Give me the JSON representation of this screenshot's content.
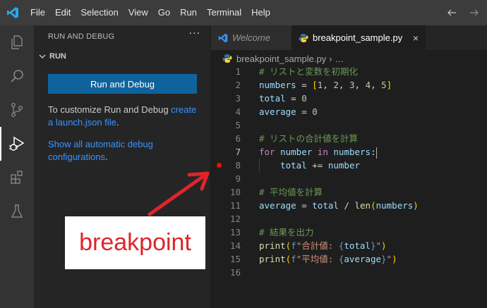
{
  "menu": [
    "File",
    "Edit",
    "Selection",
    "View",
    "Go",
    "Run",
    "Terminal",
    "Help"
  ],
  "sidebar": {
    "title": "RUN AND DEBUG",
    "more": "···",
    "section": "RUN",
    "run_button": "Run and Debug",
    "customize_text": "To customize Run and Debug ",
    "customize_link": "create a launch.json file",
    "customize_end": ".",
    "show_link": "Show all automatic debug configurations",
    "show_end": "."
  },
  "tabs": [
    {
      "label": "Welcome"
    },
    {
      "label": "breakpoint_sample.py",
      "close": "×"
    }
  ],
  "breadcrumb": {
    "file": "breakpoint_sample.py",
    "sep": "›",
    "rest": "…"
  },
  "breakpoint_line": 8,
  "current_line": 7,
  "code_lines": [
    {
      "n": "1",
      "text": "# リストと変数を初期化"
    },
    {
      "n": "2",
      "text": "numbers = [1, 2, 3, 4, 5]"
    },
    {
      "n": "3",
      "text": "total = 0"
    },
    {
      "n": "4",
      "text": "average = 0"
    },
    {
      "n": "5",
      "text": ""
    },
    {
      "n": "6",
      "text": "# リストの合計値を計算"
    },
    {
      "n": "7",
      "text": "for number in numbers:"
    },
    {
      "n": "8",
      "text": "    total += number"
    },
    {
      "n": "9",
      "text": ""
    },
    {
      "n": "10",
      "text": "# 平均値を計算"
    },
    {
      "n": "11",
      "text": "average = total / len(numbers)"
    },
    {
      "n": "12",
      "text": ""
    },
    {
      "n": "13",
      "text": "# 結果を出力"
    },
    {
      "n": "14",
      "text": "print(f\"合計値: {total}\")"
    },
    {
      "n": "15",
      "text": "print(f\"平均値: {average}\")"
    },
    {
      "n": "16",
      "text": ""
    }
  ],
  "annotation": {
    "label": "breakpoint",
    "color": "#e0242a"
  },
  "colors": {
    "accent": "#0e639c",
    "link": "#3794ff",
    "breakpoint": "#e51400"
  },
  "icons": [
    "vscode-logo-icon",
    "explorer-icon",
    "search-icon",
    "source-control-icon",
    "run-debug-icon",
    "extensions-icon",
    "testing-icon",
    "python-file-icon",
    "arrow-left-icon",
    "arrow-right-icon",
    "chevron-down-icon"
  ]
}
